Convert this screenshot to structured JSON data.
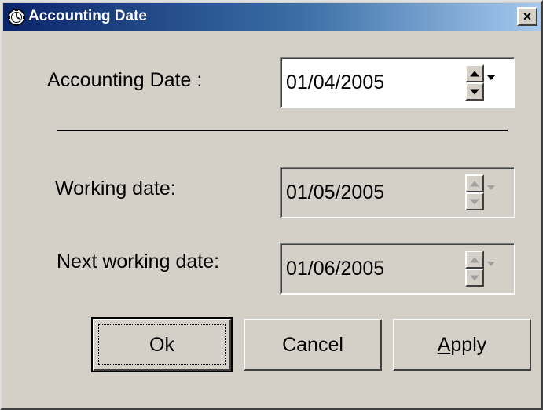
{
  "window": {
    "title": "Accounting Date",
    "close_glyph": "×",
    "icon": "clock-icon"
  },
  "fields": {
    "accounting_date": {
      "label": "Accounting Date :",
      "value": "01/04/2005",
      "enabled": true
    },
    "working_date": {
      "label": "Working date:",
      "value": "01/05/2005",
      "enabled": false
    },
    "next_working_date": {
      "label": "Next working date:",
      "value": "01/06/2005",
      "enabled": false
    }
  },
  "buttons": {
    "ok": "Ok",
    "cancel": "Cancel",
    "apply_accel": "A",
    "apply_rest": "pply"
  },
  "colors": {
    "face": "#d4d0c8",
    "title_start": "#0a246a",
    "title_end": "#a6caf0"
  }
}
